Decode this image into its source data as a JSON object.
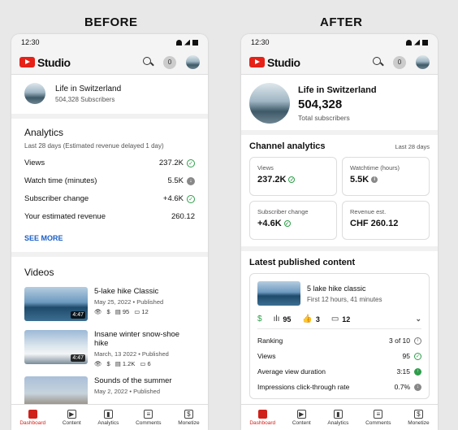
{
  "labels": {
    "before": "BEFORE",
    "after": "AFTER"
  },
  "time": "12:30",
  "app": {
    "name": "Studio",
    "notifications": "0"
  },
  "before": {
    "channel": {
      "name": "Life in Switzerland",
      "subscribers": "504,328 Subscribers"
    },
    "analytics": {
      "title": "Analytics",
      "subtitle": "Last 28 days (Estimated revenue delayed 1 day)",
      "rows": [
        {
          "label": "Views",
          "value": "237.2K",
          "trend": "up"
        },
        {
          "label": "Watch time (minutes)",
          "value": "5.5K",
          "trend": "down"
        },
        {
          "label": "Subscriber change",
          "value": "+4.6K",
          "trend": "up"
        },
        {
          "label": "Your estimated revenue",
          "value": "260.12",
          "trend": "none"
        }
      ],
      "see_more": "SEE MORE"
    },
    "videos": {
      "title": "Videos",
      "items": [
        {
          "title": "5-lake hike Classic",
          "date": "May 25, 2022 • Published",
          "duration": "4:47",
          "likes": "95",
          "comments": "12"
        },
        {
          "title": "Insane winter snow-shoe hike",
          "date": "March, 13 2022 • Published",
          "duration": "4:47",
          "likes": "1.2K",
          "comments": "6"
        },
        {
          "title": "Sounds of the summer",
          "date": "May 2, 2022 • Published",
          "duration": "",
          "likes": "",
          "comments": ""
        }
      ]
    }
  },
  "after": {
    "channel": {
      "name": "Life in Switzerland",
      "subscribers": "504,328",
      "subscribers_label": "Total subscribers"
    },
    "analytics": {
      "title": "Channel analytics",
      "period": "Last 28 days",
      "cards": [
        {
          "label": "Views",
          "value": "237.2K",
          "status": "up"
        },
        {
          "label": "Watchtime (hours)",
          "value": "5.5K",
          "status": "info"
        },
        {
          "label": "Subscriber change",
          "value": "+4.6K",
          "status": "up"
        },
        {
          "label": "Revenue est.",
          "value": "CHF 260.12",
          "status": "none"
        }
      ]
    },
    "content": {
      "title": "Latest published content",
      "video": {
        "title": "5 lake hike classic",
        "subtitle": "First 12 hours, 41 minutes"
      },
      "stats": {
        "bars": "95",
        "likes": "3",
        "comments": "12"
      },
      "metrics": [
        {
          "label": "Ranking",
          "value": "3 of 10",
          "status": "info"
        },
        {
          "label": "Views",
          "value": "95",
          "status": "check"
        },
        {
          "label": "Average view duration",
          "value": "3:15",
          "status": "up"
        },
        {
          "label": "Impressions click-through rate",
          "value": "0.7%",
          "status": "down"
        }
      ]
    }
  },
  "nav": [
    {
      "label": "Dashboard",
      "icon": "dashboard-icon",
      "glyph": "▦"
    },
    {
      "label": "Content",
      "icon": "content-icon",
      "glyph": "▶"
    },
    {
      "label": "Analytics",
      "icon": "analytics-icon",
      "glyph": "▮"
    },
    {
      "label": "Comments",
      "icon": "comments-icon",
      "glyph": "≡"
    },
    {
      "label": "Monetize",
      "icon": "monetize-icon",
      "glyph": "$"
    }
  ]
}
